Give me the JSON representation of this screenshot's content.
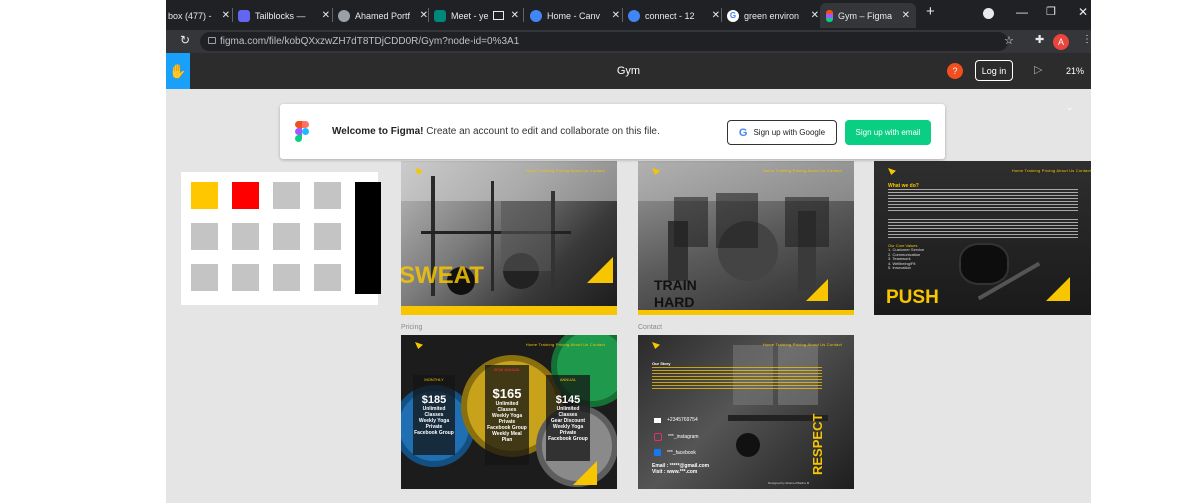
{
  "tabs": [
    {
      "label": "box (477) - ",
      "fav_color": "#c5221f"
    },
    {
      "label": "Tailblocks — ",
      "fav_color": "#6366f1"
    },
    {
      "label": "Ahamed Portf",
      "fav_color": "#9aa0a6"
    },
    {
      "label": "Meet - ye",
      "fav_color": "#00897b"
    },
    {
      "label": "Home - Canv",
      "fav_color": "#4285f4"
    },
    {
      "label": "connect - 12",
      "fav_color": "#4285f4"
    },
    {
      "label": "green environ",
      "fav_color": "#ffffff"
    },
    {
      "label": "Gym – Figma",
      "fav_color": "#f24e1e"
    }
  ],
  "browser": {
    "url": "figma.com/file/kobQXxzwZH7dT8TDjCDD0R/Gym?node-id=0%3A1",
    "new_tab_label": "+",
    "profile_initial": "A",
    "minimize": "—",
    "restore": "❐",
    "close": "✕"
  },
  "toolbar": {
    "file_title": "Gym",
    "help_label": "?",
    "login_label": "Log in",
    "zoom_label": "21%"
  },
  "welcome": {
    "title": "Welcome to Figma!",
    "message": " Create an account to edit and collaborate on this file.",
    "google_label": "Sign up with Google",
    "email_label": "Sign up with email"
  },
  "colors": {
    "accent": "#f7c600",
    "red": "#ff0000",
    "gray": "#c4c4c4",
    "black": "#000000",
    "figma_blue": "#18a0fb",
    "figma_green": "#0acf83"
  },
  "canvas": {
    "frame_labels": {
      "pricing": "Pricing",
      "contact": "Contact"
    },
    "sweat": {
      "word": "SWEAT",
      "nav": "Home   Training   Pricing   About Us   Contact"
    },
    "train": {
      "word1": "TRAIN",
      "word2": "HARD",
      "nav": "Home   Training   Pricing   About Us   Contact"
    },
    "push": {
      "word": "PUSH",
      "nav": "Home   Training   Pricing   About Us   Contact",
      "heading": "What we do?",
      "values_title": "Our Core Values",
      "values": [
        "1. Customer Service",
        "2. Communication",
        "3. Teamwork",
        "4. Wellbeing/Fit",
        "5. Innovation"
      ]
    },
    "pricing": {
      "nav": "Home   Training   Pricing   About Us   Contact",
      "cards": [
        {
          "tag": "MONTHLY",
          "price": "$185",
          "features": [
            "Unlimited",
            "Classes",
            "Weekly Yoga",
            "Private",
            "Facebook Group"
          ]
        },
        {
          "tag": "SEMI ANNUAL",
          "price": "$165",
          "features": [
            "Unlimited",
            "Classes",
            "Weekly Yoga",
            "Private",
            "Facebook Group",
            "Weekly Meal",
            "Plan"
          ]
        },
        {
          "tag": "ANNUAL",
          "price": "$145",
          "features": [
            "Unlimited",
            "Classes",
            "Gear Discount",
            "Weekly Yoga",
            "Private",
            "Facebook Group"
          ]
        }
      ]
    },
    "contact": {
      "nav": "Home   Training   Pricing   About Us   Contact",
      "story_title": "Our Story",
      "phone": "+2345769754",
      "instagram": "***_instagram",
      "facebook": "***_facebook",
      "email": "Email : *****@gmail.com",
      "visit": "Visit : www.***.com",
      "word": "RESPECT",
      "credit": "Designed by Ahamed Basha M"
    }
  }
}
